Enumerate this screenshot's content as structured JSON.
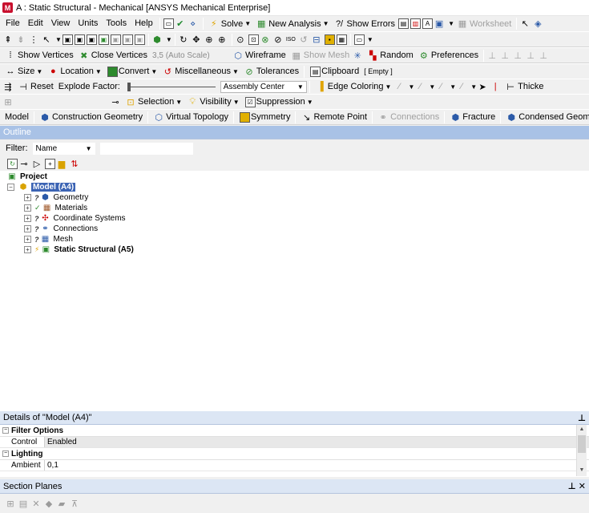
{
  "window": {
    "title": "A : Static Structural - Mechanical [ANSYS Mechanical Enterprise]",
    "app_icon": "M"
  },
  "menu": [
    "File",
    "Edit",
    "View",
    "Units",
    "Tools",
    "Help"
  ],
  "toolbar1": {
    "solve": "Solve",
    "new_analysis": "New Analysis",
    "show_errors": "Show Errors",
    "worksheet": "Worksheet"
  },
  "toolbar3": {
    "show_vertices": "Show Vertices",
    "close_vertices": "Close Vertices",
    "scale": "3,5 (Auto Scale)",
    "wireframe": "Wireframe",
    "show_mesh": "Show Mesh",
    "random": "Random",
    "preferences": "Preferences"
  },
  "toolbar4": {
    "size": "Size",
    "location": "Location",
    "convert": "Convert",
    "miscellaneous": "Miscellaneous",
    "tolerances": "Tolerances",
    "clipboard": "Clipboard",
    "clipboard_value": "[ Empty ]"
  },
  "toolbar5": {
    "reset": "Reset",
    "explode_factor": "Explode Factor:",
    "assembly_center": "Assembly Center",
    "edge_coloring": "Edge Coloring",
    "thicken": "Thicke"
  },
  "toolbar6": {
    "selection": "Selection",
    "visibility": "Visibility",
    "suppression": "Suppression"
  },
  "model_toolbar": {
    "model": "Model",
    "construction_geometry": "Construction Geometry",
    "virtual_topology": "Virtual Topology",
    "symmetry": "Symmetry",
    "remote_point": "Remote Point",
    "connections": "Connections",
    "fracture": "Fracture",
    "condensed_geometry": "Condensed Geometry"
  },
  "outline": {
    "title": "Outline",
    "filter_label": "Filter:",
    "filter_value": "Name",
    "project": "Project",
    "model": "Model (A4)",
    "children": [
      "Geometry",
      "Materials",
      "Coordinate Systems",
      "Connections",
      "Mesh",
      "Static Structural (A5)"
    ]
  },
  "details": {
    "title": "Details of \"Model (A4)\"",
    "groups": [
      {
        "name": "Filter Options",
        "rows": [
          {
            "key": "Control",
            "value": "Enabled"
          }
        ]
      },
      {
        "name": "Lighting",
        "rows": [
          {
            "key": "Ambient",
            "value": "0,1"
          }
        ]
      }
    ]
  },
  "section_planes": {
    "title": "Section Planes"
  },
  "colors": {
    "outline_header": "#a9c2e6",
    "panel_header": "#dce6f4",
    "selection": "#3c64b4"
  }
}
